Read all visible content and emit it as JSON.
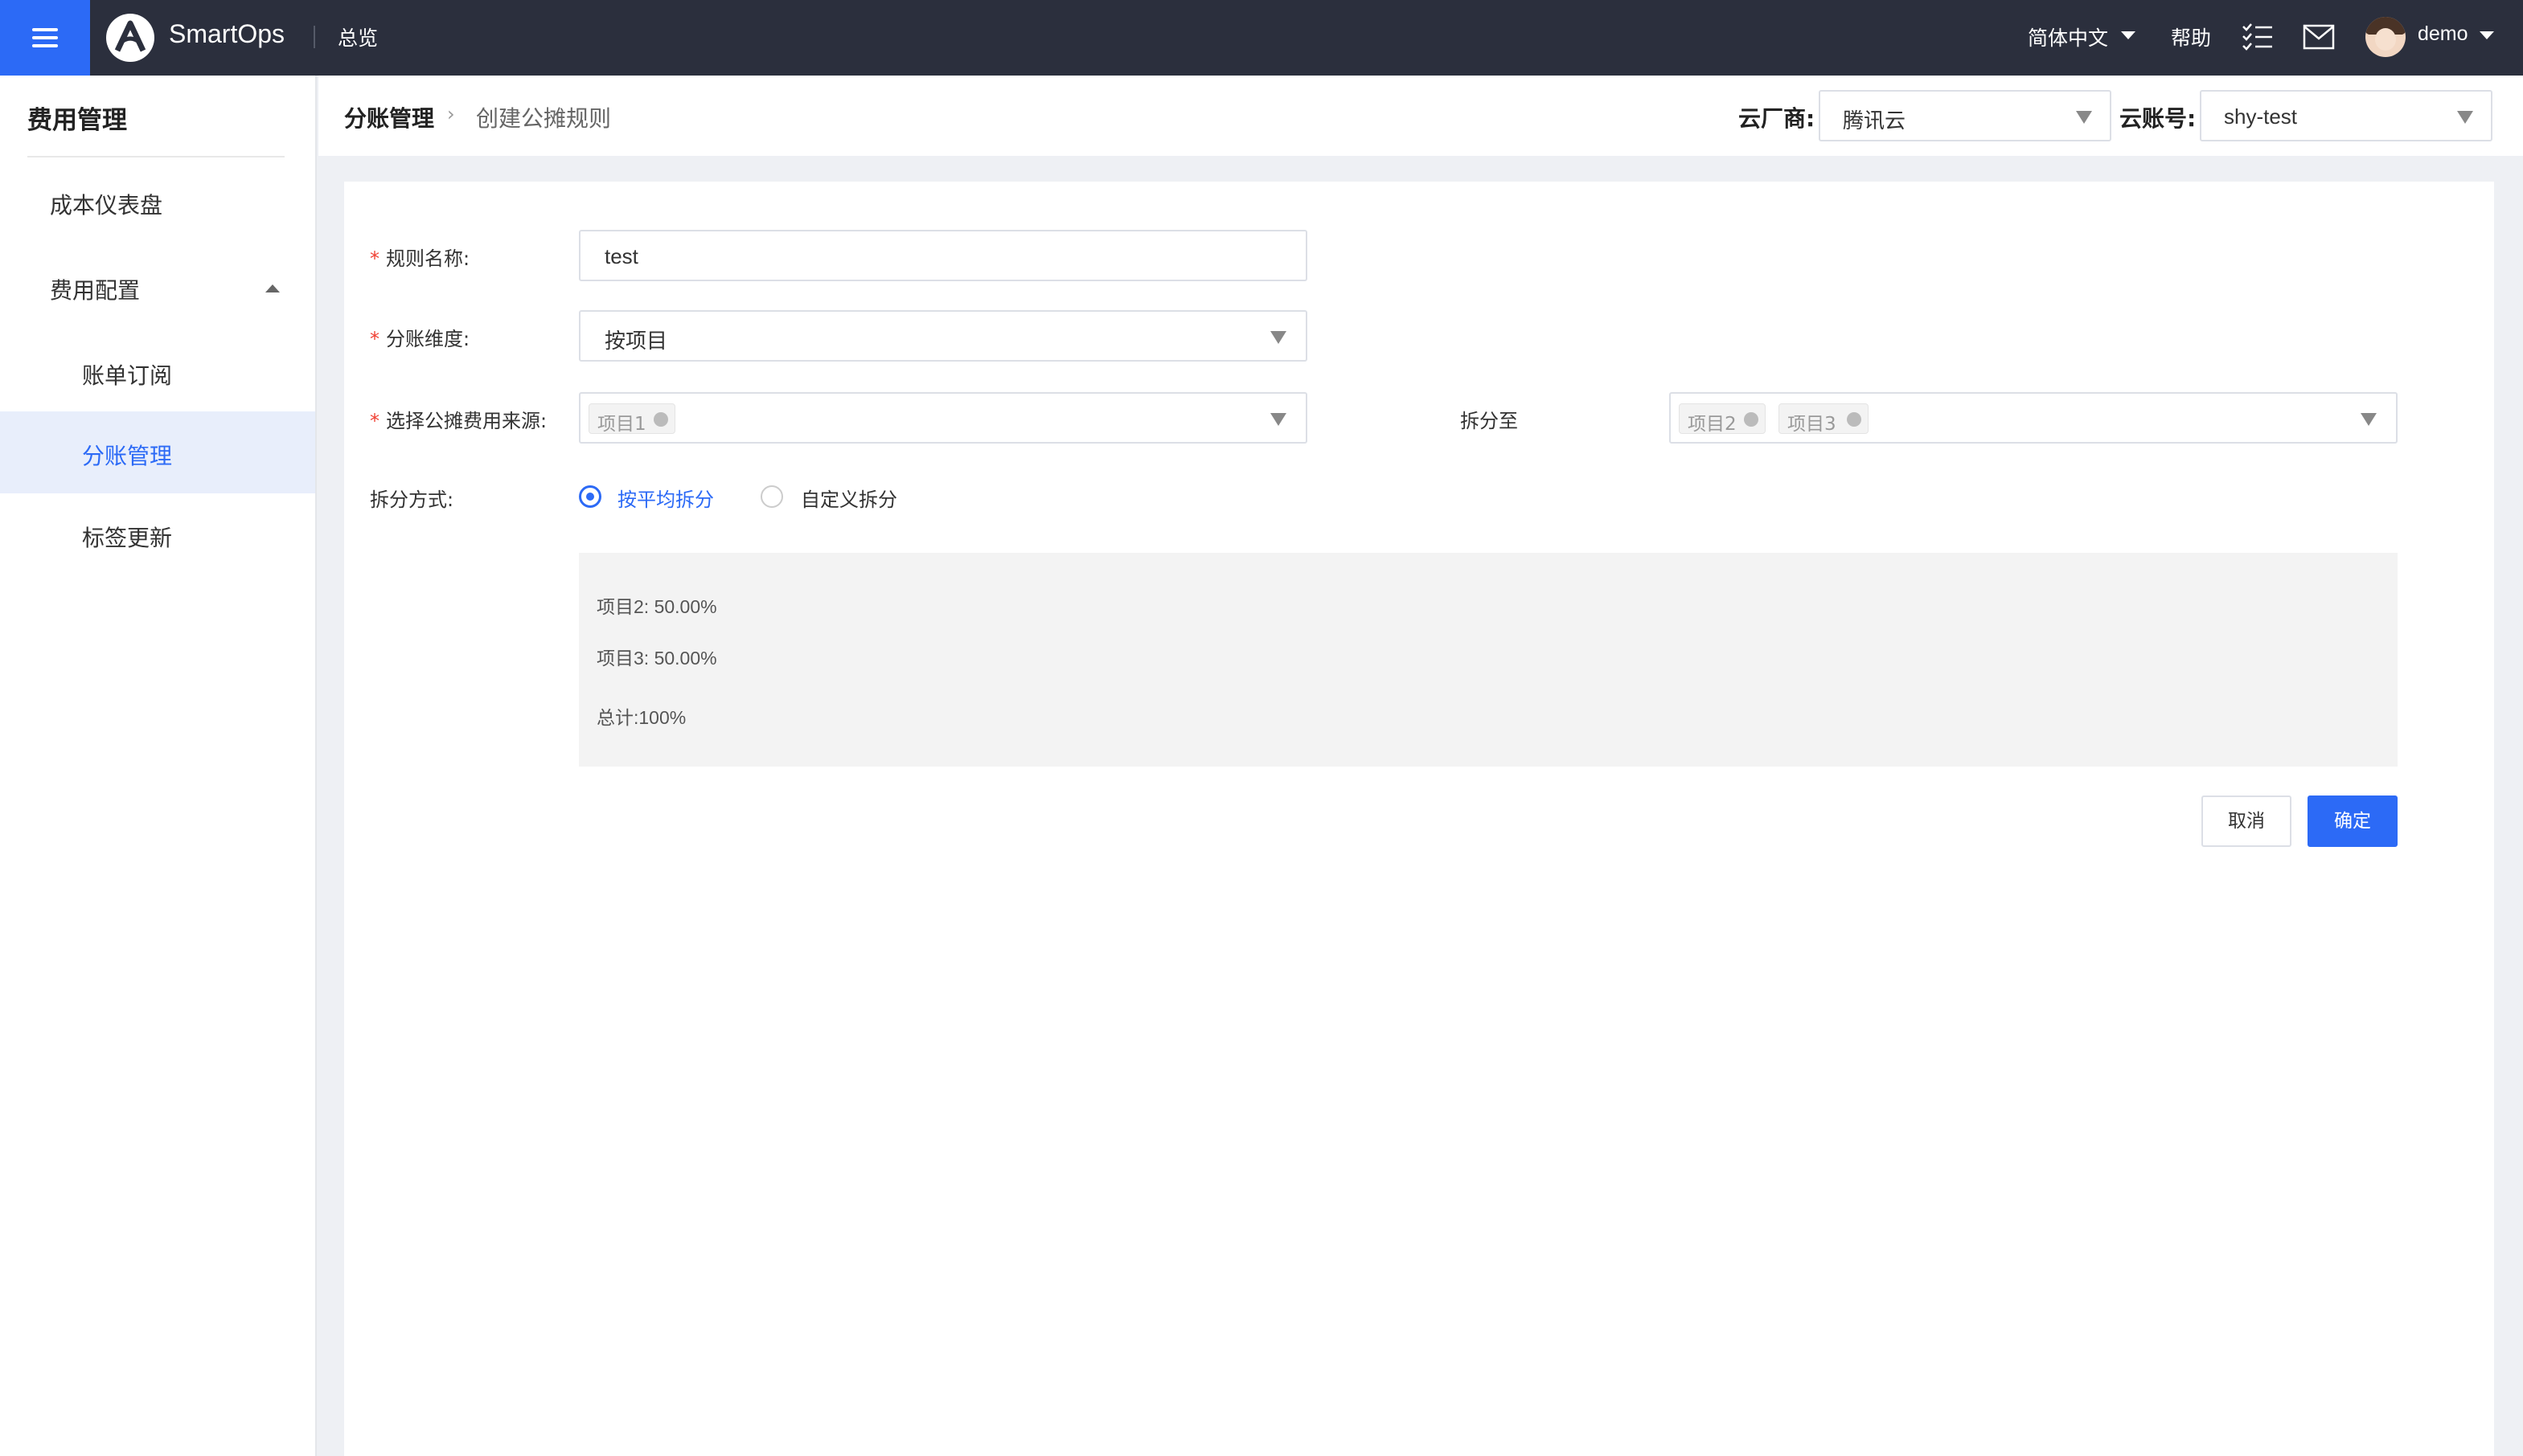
{
  "topbar": {
    "brand": "SmartOps",
    "overview": "总览",
    "language": "简体中文",
    "help": "帮助",
    "user": "demo",
    "icons": [
      "menu-icon",
      "logo",
      "task-list-icon",
      "mail-icon",
      "avatar"
    ]
  },
  "sidebar": {
    "title": "费用管理",
    "items": [
      {
        "label": "成本仪表盘"
      },
      {
        "label": "费用配置"
      },
      {
        "label": "账单订阅"
      },
      {
        "label": "分账管理"
      },
      {
        "label": "标签更新"
      }
    ],
    "active_item": "分账管理"
  },
  "breadcrumb": {
    "parent": "分账管理",
    "current": "创建公摊规则"
  },
  "header": {
    "provider_label": "云厂商:",
    "provider_value": "腾讯云",
    "account_label": "云账号:",
    "account_value": "shy-test"
  },
  "form": {
    "rule_name_label": "规则名称:",
    "rule_name_value": "test",
    "dimension_label": "分账维度:",
    "dimension_value": "按项目",
    "source_label": "选择公摊费用来源:",
    "source_tags": [
      "项目1"
    ],
    "split_to_label": "拆分至",
    "split_to_tags": [
      "项目2",
      "项目3"
    ],
    "method_label": "拆分方式:",
    "method_options": [
      "按平均拆分",
      "自定义拆分"
    ],
    "method_selected": "按平均拆分"
  },
  "summary": {
    "line1": "项目2: 50.00%",
    "line2": "项目3: 50.00%",
    "total": "总计:100%"
  },
  "buttons": {
    "cancel": "取消",
    "confirm": "确定"
  },
  "colors": {
    "primary": "#2c6af6",
    "topbar": "#2b2f3d",
    "required": "#f04134"
  }
}
